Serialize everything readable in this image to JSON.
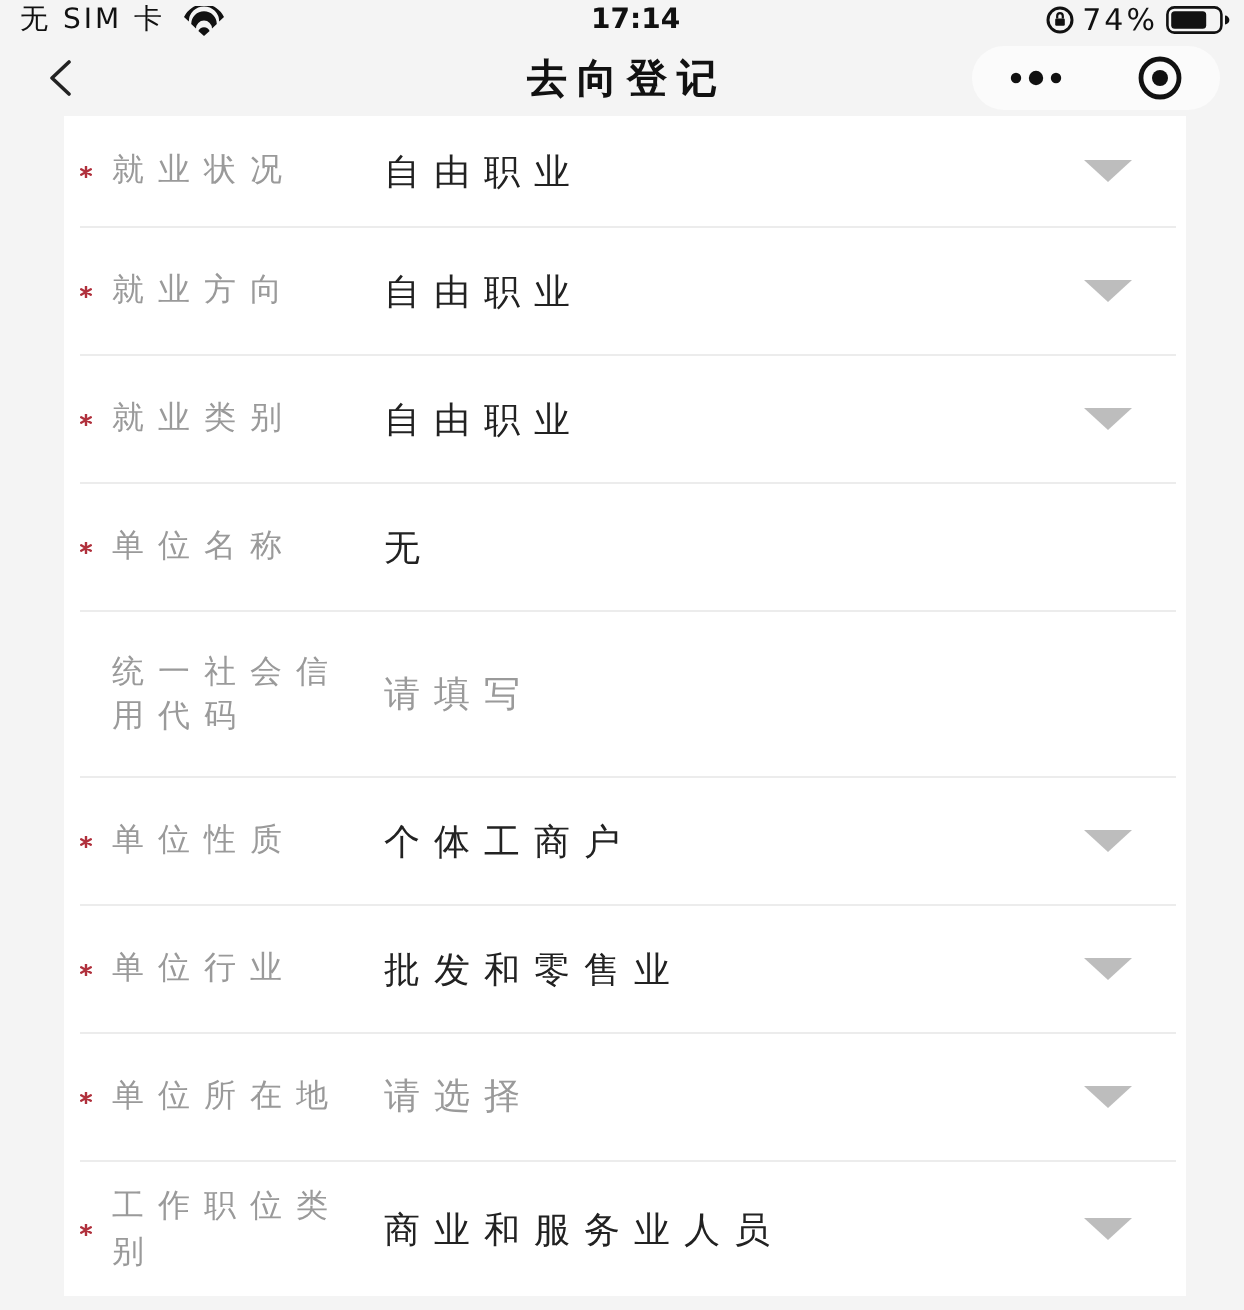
{
  "status_bar": {
    "carrier": "无 SIM 卡",
    "time": "17:14",
    "battery": "74%"
  },
  "nav_bar": {
    "title": "去向登记"
  },
  "form": {
    "fields": [
      {
        "label": "就业状况",
        "required": true,
        "kind": "select",
        "value": "自由职业"
      },
      {
        "label": "就业方向",
        "required": true,
        "kind": "select",
        "value": "自由职业"
      },
      {
        "label": "就业类别",
        "required": true,
        "kind": "select",
        "value": "自由职业"
      },
      {
        "label": "单位名称",
        "required": true,
        "kind": "input",
        "value": "无"
      },
      {
        "label": "统一社会信用代码",
        "required": false,
        "kind": "input",
        "placeholder": "请填写"
      },
      {
        "label": "单位性质",
        "required": true,
        "kind": "select",
        "value": "个体工商户"
      },
      {
        "label": "单位行业",
        "required": true,
        "kind": "select",
        "value": "批发和零售业"
      },
      {
        "label": "单位所在地",
        "required": true,
        "kind": "select",
        "placeholder": "请选择"
      },
      {
        "label": "工作职位类别",
        "required": true,
        "kind": "select",
        "value": "商业和服务业人员"
      }
    ]
  }
}
